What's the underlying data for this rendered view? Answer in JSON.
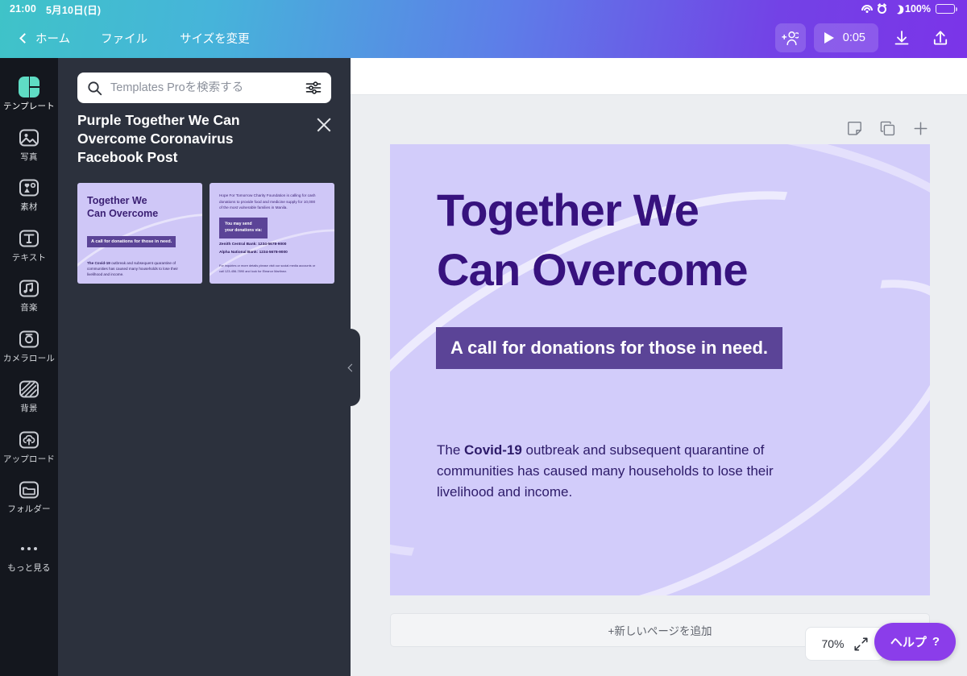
{
  "status_bar": {
    "time": "21:00",
    "date": "5月10日(日)",
    "battery_percent": "100%",
    "icons": [
      "wifi-icon",
      "alarm-icon",
      "moon-icon",
      "battery-icon"
    ]
  },
  "nav": {
    "back_label": "ホーム",
    "file_label": "ファイル",
    "resize_label": "サイズを変更",
    "collab_icon": "add-people-icon",
    "play_time": "0:05",
    "download_icon": "download-icon",
    "share_icon": "share-icon"
  },
  "sidebar": {
    "items": [
      {
        "label": "テンプレート",
        "icon": "templates-icon",
        "active": true
      },
      {
        "label": "写真",
        "icon": "photo-icon",
        "active": false
      },
      {
        "label": "素材",
        "icon": "elements-icon",
        "active": false
      },
      {
        "label": "テキスト",
        "icon": "text-icon",
        "active": false
      },
      {
        "label": "音楽",
        "icon": "music-icon",
        "active": false
      },
      {
        "label": "カメラロール",
        "icon": "camera-roll-icon",
        "active": false
      },
      {
        "label": "背景",
        "icon": "background-icon",
        "active": false
      },
      {
        "label": "アップロード",
        "icon": "upload-icon",
        "active": false
      },
      {
        "label": "フォルダー",
        "icon": "folder-icon",
        "active": false
      },
      {
        "label": "もっと見る",
        "icon": "more-dots-icon",
        "active": false
      }
    ]
  },
  "panel": {
    "search_placeholder": "Templates Proを検索する",
    "search_value": "",
    "search_icon": "search-icon",
    "filter_icon": "filter-sliders-icon",
    "title": "Purple Together We Can Overcome Coronavirus Facebook Post",
    "close_icon": "close-icon",
    "collapse_icon": "chevron-left-icon",
    "thumbnails": [
      {
        "name": "template-thumbnail-1",
        "title": "Together We\nCan Overcome",
        "band": "A call for donations for those in need.",
        "body": "The Covid-19 outbreak and subsequent quarantine of communities has caused many households to lose their livelihood and income."
      },
      {
        "name": "template-thumbnail-2",
        "top": "Hope For Tomorrow Charity Foundation is calling for cash donations to provide food and medicine supply for 10,000 of the most vulnerable families in Manila.",
        "band": "You may send\nyour donations via:",
        "bank1": "Zenith Central Bank: 1234-5678-9000",
        "bank2": "Alpha National Bank: 1234-5678-9000",
        "foot": "For inquiries or more details please visit our social media accounts or call 123-456-7890 and look for Eleanor Martinez."
      }
    ]
  },
  "page_tools": {
    "notes_icon": "sticky-note-icon",
    "duplicate_icon": "duplicate-page-icon",
    "add_icon": "plus-icon"
  },
  "design": {
    "title_line1": "Together We",
    "title_line2": "Can Overcome",
    "band_text": "A call for donations for those in need.",
    "body_prefix": "The ",
    "body_bold": "Covid-19",
    "body_rest": " outbreak and subsequent quarantine of communities has caused many households to lose their livelihood and income.",
    "background_color": "#d2ccfa",
    "title_color": "#37127e",
    "band_color": "#5b4497"
  },
  "footer": {
    "add_page_label": "+新しいページを追加",
    "zoom_level": "70%",
    "fit_icon": "expand-arrows-icon",
    "help_label": "ヘルプ",
    "help_mark": "?",
    "help_color": "#8b3dea"
  }
}
